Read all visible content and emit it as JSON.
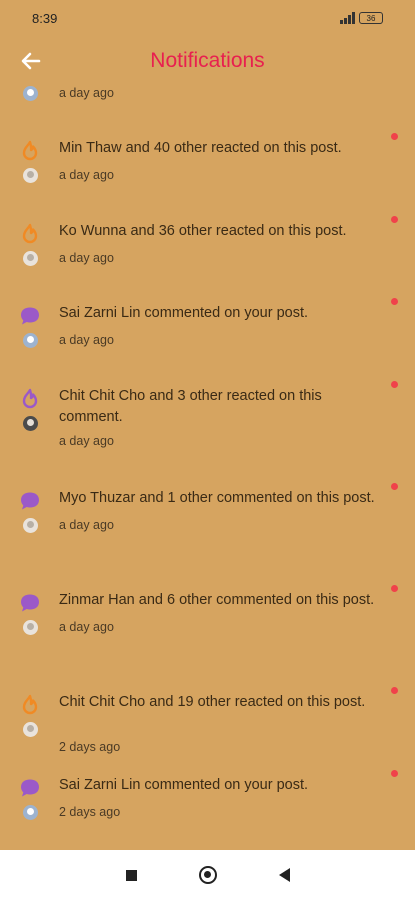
{
  "status_bar": {
    "time": "8:39",
    "battery": "36"
  },
  "header": {
    "title": "Notifications",
    "back_icon": "arrow-left-icon"
  },
  "colors": {
    "background": "#D6A460",
    "title": "#E8204F",
    "unread_dot": "#F0424A",
    "reaction_icon": "#F08A24",
    "comment_icon": "#9B59C8"
  },
  "partial_item": {
    "time": "a day ago"
  },
  "notifications": [
    {
      "type": "reaction",
      "icon": "fire-reaction-icon",
      "text": "Min Thaw and 40 other reacted on this post.",
      "time": "a day ago",
      "unread": true
    },
    {
      "type": "reaction",
      "icon": "fire-reaction-icon",
      "text": "Ko Wunna and 36 other reacted on this post.",
      "time": "a day ago",
      "unread": true
    },
    {
      "type": "comment",
      "icon": "comment-bubble-icon",
      "text": "Sai Zarni Lin commented on your post.",
      "time": "a day ago",
      "unread": true
    },
    {
      "type": "reaction",
      "icon": "fire-reaction-icon",
      "text": "Chit Chit Cho and 3 other reacted on this comment.",
      "time": "a day ago",
      "unread": true
    },
    {
      "type": "comment",
      "icon": "comment-bubble-icon",
      "text": "Myo Thuzar and 1 other commented on this post.",
      "time": "a day ago",
      "unread": true
    },
    {
      "type": "comment",
      "icon": "comment-bubble-icon",
      "text": "Zinmar Han and 6 other commented on this post.",
      "time": "a day ago",
      "unread": true
    },
    {
      "type": "reaction",
      "icon": "fire-reaction-icon",
      "text": "Chit Chit Cho and 19 other reacted on this post.",
      "time": "2 days ago",
      "unread": true
    },
    {
      "type": "comment",
      "icon": "comment-bubble-icon",
      "text": "Sai Zarni Lin commented on your post.",
      "time": "2 days ago",
      "unread": true
    }
  ],
  "nav": {
    "recents": "square-icon",
    "home": "circle-icon",
    "back": "triangle-back-icon"
  }
}
